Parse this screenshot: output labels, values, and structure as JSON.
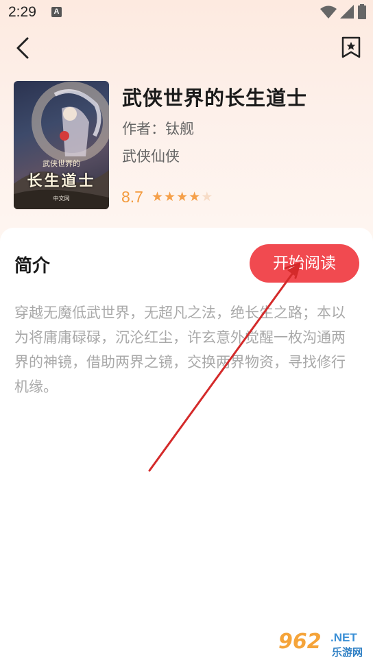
{
  "status_bar": {
    "time": "2:29",
    "notification_icon": "A"
  },
  "book": {
    "title": "武侠世界的长生道士",
    "author": "作者：钛舰",
    "genre": "武侠仙侠",
    "rating": "8.7",
    "stars_filled": 4,
    "stars_total": 5,
    "cover": {
      "small_title": "武侠世界的",
      "big_title": "长生道士",
      "publisher": "中文网"
    }
  },
  "intro": {
    "heading": "简介",
    "read_button": "开始阅读",
    "text": "穿越无魔低武世界，无超凡之法，绝长生之路；本以为将庸庸碌碌，沉沦红尘，许玄意外觉醒一枚沟通两界的神镜，借助两界之镜，交换两界物资，寻找修行机缘。"
  },
  "watermark": {
    "number": "962",
    "net": ".NET",
    "sub": "乐游网"
  },
  "colors": {
    "accent": "#f14a50",
    "rating": "#f39a3c",
    "annotation_arrow": "#d42a2a"
  }
}
